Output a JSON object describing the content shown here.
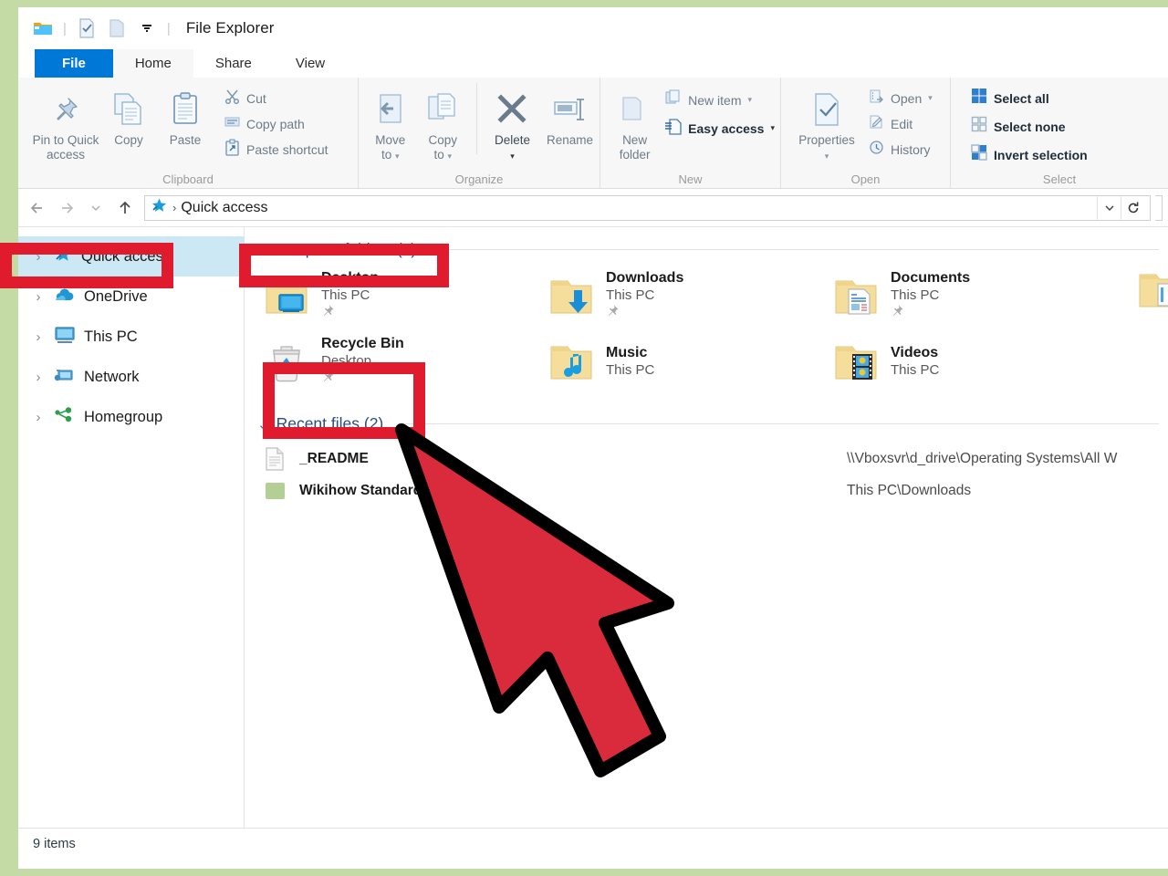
{
  "window": {
    "title": "File Explorer",
    "quick_access_icons": [
      "folder-icon",
      "properties-icon",
      "new-folder-icon",
      "chevron-down-icon"
    ]
  },
  "tabs": [
    {
      "label": "File",
      "state": "file"
    },
    {
      "label": "Home",
      "state": "active"
    },
    {
      "label": "Share",
      "state": "normal"
    },
    {
      "label": "View",
      "state": "normal"
    }
  ],
  "ribbon": {
    "groups": [
      {
        "label": "Clipboard",
        "big_buttons": [
          {
            "label": "Pin to Quick\naccess",
            "line1": "Pin to Quick",
            "line2": "access",
            "icon": "pin-icon"
          },
          {
            "label": "Copy",
            "line1": "Copy",
            "line2": "",
            "icon": "copy-icon"
          },
          {
            "label": "Paste",
            "line1": "Paste",
            "line2": "",
            "icon": "paste-icon"
          }
        ],
        "small_buttons": [
          {
            "label": "Cut",
            "icon": "scissors-icon"
          },
          {
            "label": "Copy path",
            "icon": "copy-path-icon"
          },
          {
            "label": "Paste shortcut",
            "icon": "paste-shortcut-icon"
          }
        ]
      },
      {
        "label": "Organize",
        "big_buttons": [
          {
            "line1": "Move",
            "line2": "to",
            "icon": "move-to-icon",
            "has_caret": true
          },
          {
            "line1": "Copy",
            "line2": "to",
            "icon": "copy-to-icon",
            "has_caret": true
          },
          {
            "line1": "Delete",
            "line2": "",
            "icon": "delete-x-icon",
            "has_caret": true,
            "dark": true
          },
          {
            "line1": "Rename",
            "line2": "",
            "icon": "rename-icon"
          }
        ],
        "small_buttons": []
      },
      {
        "label": "New",
        "big_buttons": [
          {
            "line1": "New",
            "line2": "folder",
            "icon": "new-folder-icon"
          }
        ],
        "small_buttons": [
          {
            "label": "New item",
            "icon": "new-item-icon",
            "has_caret": true
          },
          {
            "label": "Easy access",
            "icon": "easy-access-icon",
            "has_caret": true,
            "bold": true
          }
        ]
      },
      {
        "label": "Open",
        "big_buttons": [
          {
            "line1": "Properties",
            "line2": "",
            "icon": "properties-icon",
            "has_caret": true
          }
        ],
        "small_buttons": [
          {
            "label": "Open",
            "icon": "open-icon",
            "has_caret": true
          },
          {
            "label": "Edit",
            "icon": "edit-icon"
          },
          {
            "label": "History",
            "icon": "history-icon"
          }
        ]
      },
      {
        "label": "Select",
        "big_buttons": [],
        "small_buttons": [
          {
            "label": "Select all",
            "icon": "select-all-icon",
            "bold": true
          },
          {
            "label": "Select none",
            "icon": "select-none-icon",
            "bold": true
          },
          {
            "label": "Invert selection",
            "icon": "invert-selection-icon",
            "bold": true
          }
        ]
      }
    ]
  },
  "address_bar": {
    "back_icon": "arrow-left-icon",
    "forward_icon": "arrow-right-icon",
    "recent_icon": "chevron-down-icon",
    "up_icon": "arrow-up-icon",
    "location_icon": "quick-access-star-icon",
    "separator": "›",
    "path": "Quick access",
    "dropdown_icon": "chevron-down-icon",
    "refresh_icon": "refresh-icon"
  },
  "nav_pane": {
    "items": [
      {
        "label": "Quick access",
        "icon": "quick-access-star-icon",
        "selected": true
      },
      {
        "label": "OneDrive",
        "icon": "onedrive-cloud-icon",
        "selected": false
      },
      {
        "label": "This PC",
        "icon": "this-pc-monitor-icon",
        "selected": false
      },
      {
        "label": "Network",
        "icon": "network-icon",
        "selected": false
      },
      {
        "label": "Homegroup",
        "icon": "homegroup-icon",
        "selected": false
      }
    ]
  },
  "content": {
    "frequent_folders": {
      "title": "Frequent folders (7)",
      "chevron": "chevron-down-icon",
      "items": [
        {
          "name": "Desktop",
          "location": "This PC",
          "icon": "folder-desktop-icon",
          "pinned": true
        },
        {
          "name": "Downloads",
          "location": "This PC",
          "icon": "folder-downloads-icon",
          "pinned": true
        },
        {
          "name": "Documents",
          "location": "This PC",
          "icon": "folder-documents-icon",
          "pinned": true
        },
        {
          "name": "Recycle Bin",
          "location": "Desktop",
          "icon": "recycle-bin-icon",
          "pinned": true
        },
        {
          "name": "Music",
          "location": "This PC",
          "icon": "folder-music-icon",
          "pinned": false
        },
        {
          "name": "Videos",
          "location": "This PC",
          "icon": "folder-videos-icon",
          "pinned": false
        }
      ]
    },
    "recent_files": {
      "title": "Recent files (2)",
      "chevron": "chevron-down-icon",
      "items": [
        {
          "name": "_README",
          "path": "\\\\Vboxsvr\\d_drive\\Operating Systems\\All W",
          "icon": "text-document-icon"
        },
        {
          "name": "Wikihow Standard Gr",
          "path": "This PC\\Downloads",
          "icon": "green-image-icon"
        }
      ]
    }
  },
  "status_bar": {
    "item_count": "9 items"
  },
  "annotations": {
    "highlight_color": "#e01b2d",
    "boxes": [
      {
        "name": "quick-access-nav-highlight"
      },
      {
        "name": "frequent-folders-header-highlight"
      },
      {
        "name": "recycle-bin-tile-highlight"
      }
    ],
    "cursor": {
      "name": "pointer-cursor",
      "fill": "#d92b3c",
      "stroke": "#000000"
    }
  },
  "colors": {
    "page_background": "#c5dba5",
    "file_tab": "#0078d7",
    "selection": "#cce8f4",
    "section_title": "#2a4c7d"
  }
}
